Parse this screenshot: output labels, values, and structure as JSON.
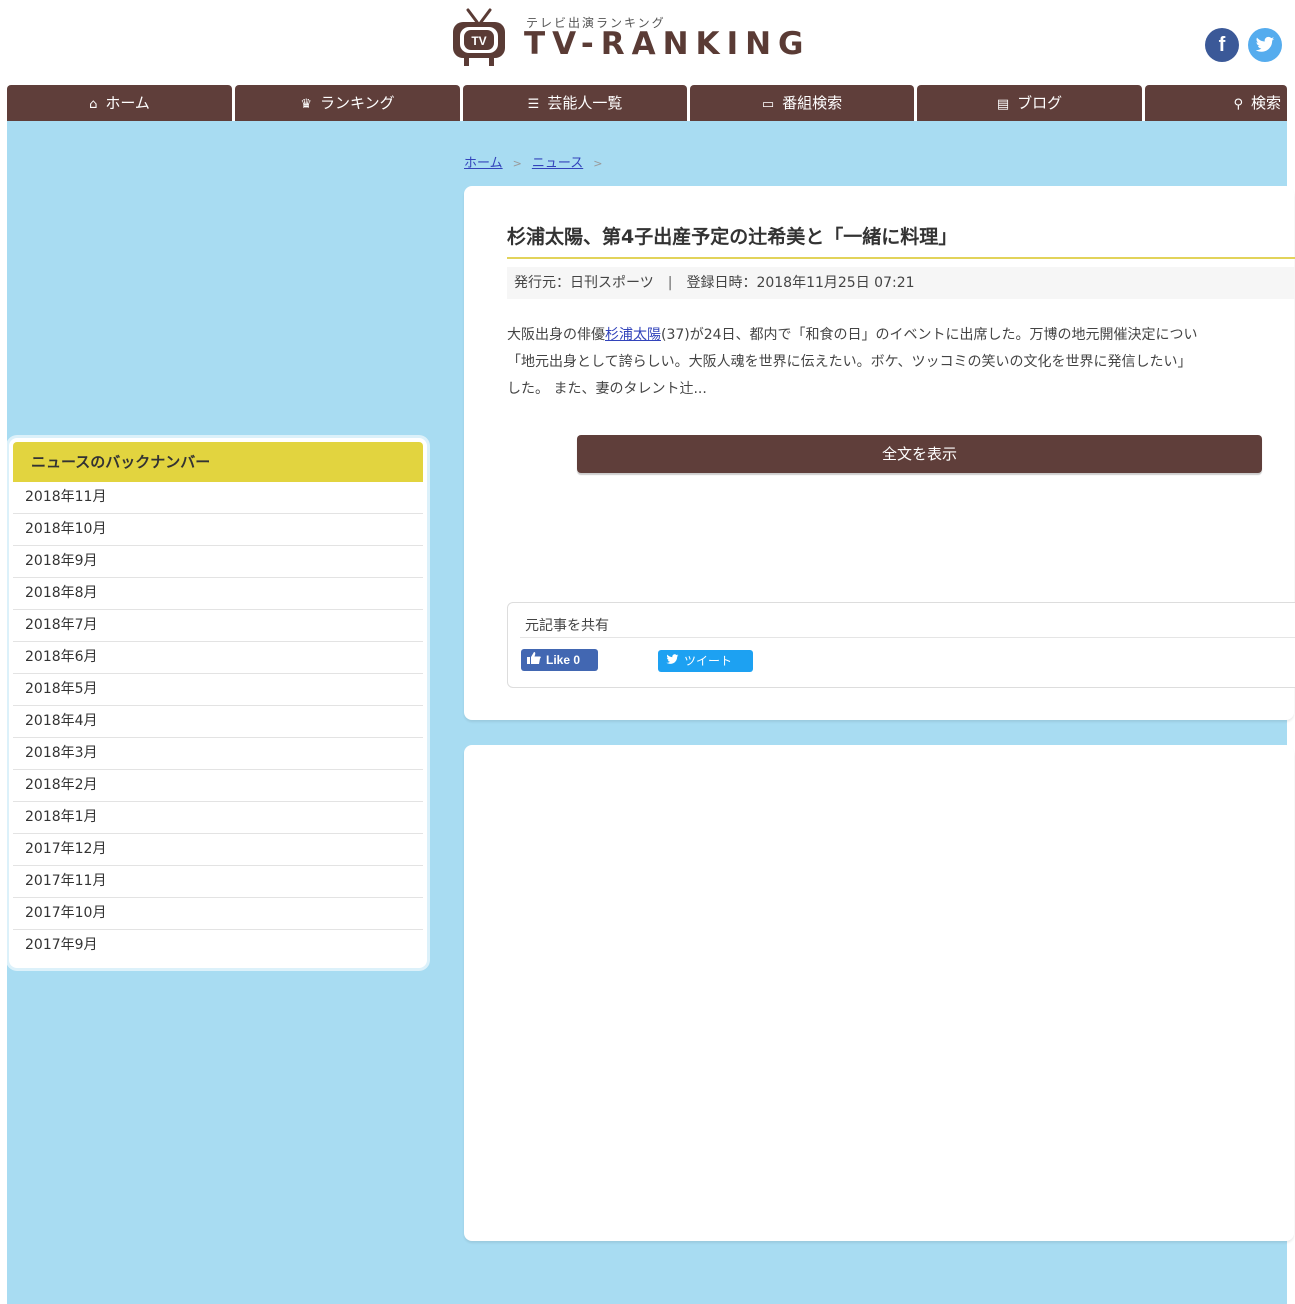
{
  "header": {
    "logo_sub": "テレビ出演ランキング",
    "logo_main": "TV-RANKING",
    "logo_tv_text": "TV",
    "facebook_label": "f",
    "twitter_label": "t"
  },
  "nav": {
    "items": [
      {
        "label": "ホーム",
        "icon": "home-icon",
        "glyph": "⌂"
      },
      {
        "label": "ランキング",
        "icon": "crown-icon",
        "glyph": "♛"
      },
      {
        "label": "芸能人一覧",
        "icon": "list-icon",
        "glyph": "☰"
      },
      {
        "label": "番組検索",
        "icon": "monitor-icon",
        "glyph": "▭"
      },
      {
        "label": "ブログ",
        "icon": "blog-icon",
        "glyph": "▤"
      },
      {
        "label": "検索",
        "icon": "search-icon",
        "glyph": "⚲"
      }
    ]
  },
  "breadcrumb": {
    "home": "ホーム",
    "news": "ニュース",
    "sep": ">"
  },
  "article": {
    "title": "杉浦太陽、第4子出産予定の辻希美と「一緒に料理」",
    "publisher": "発行元：日刊スポーツ",
    "separator": "|",
    "registered": "登録日時：2018年11月25日 07:21",
    "body_line1_pre": "大阪出身の俳優",
    "body_line1_link": "杉浦太陽",
    "body_line1_post": "(37)が24日、都内で「和食の日」のイベントに出席した。万博の地元開催決定につい",
    "body_line2": "「地元出身として誇らしい。大阪人魂を世界に伝えたい。ボケ、ツッコミの笑いの文化を世界に発信したい」",
    "body_line3": "した。 また、妻のタレント辻...",
    "full_text_button": "全文を表示"
  },
  "share": {
    "label": "元記事を共有",
    "like": "Like 0",
    "tweet": "ツイート"
  },
  "sidebar": {
    "heading": "ニュースのバックナンバー",
    "months": [
      "2018年11月",
      "2018年10月",
      "2018年9月",
      "2018年8月",
      "2018年7月",
      "2018年6月",
      "2018年5月",
      "2018年4月",
      "2018年3月",
      "2018年2月",
      "2018年1月",
      "2017年12月",
      "2017年11月",
      "2017年10月",
      "2017年9月"
    ]
  },
  "colors": {
    "nav_bg": "#5f3e3a",
    "page_bg": "#a8dcf2",
    "sidebar_head": "#e2d43f",
    "facebook": "#3b5998",
    "twitter": "#55acee"
  }
}
